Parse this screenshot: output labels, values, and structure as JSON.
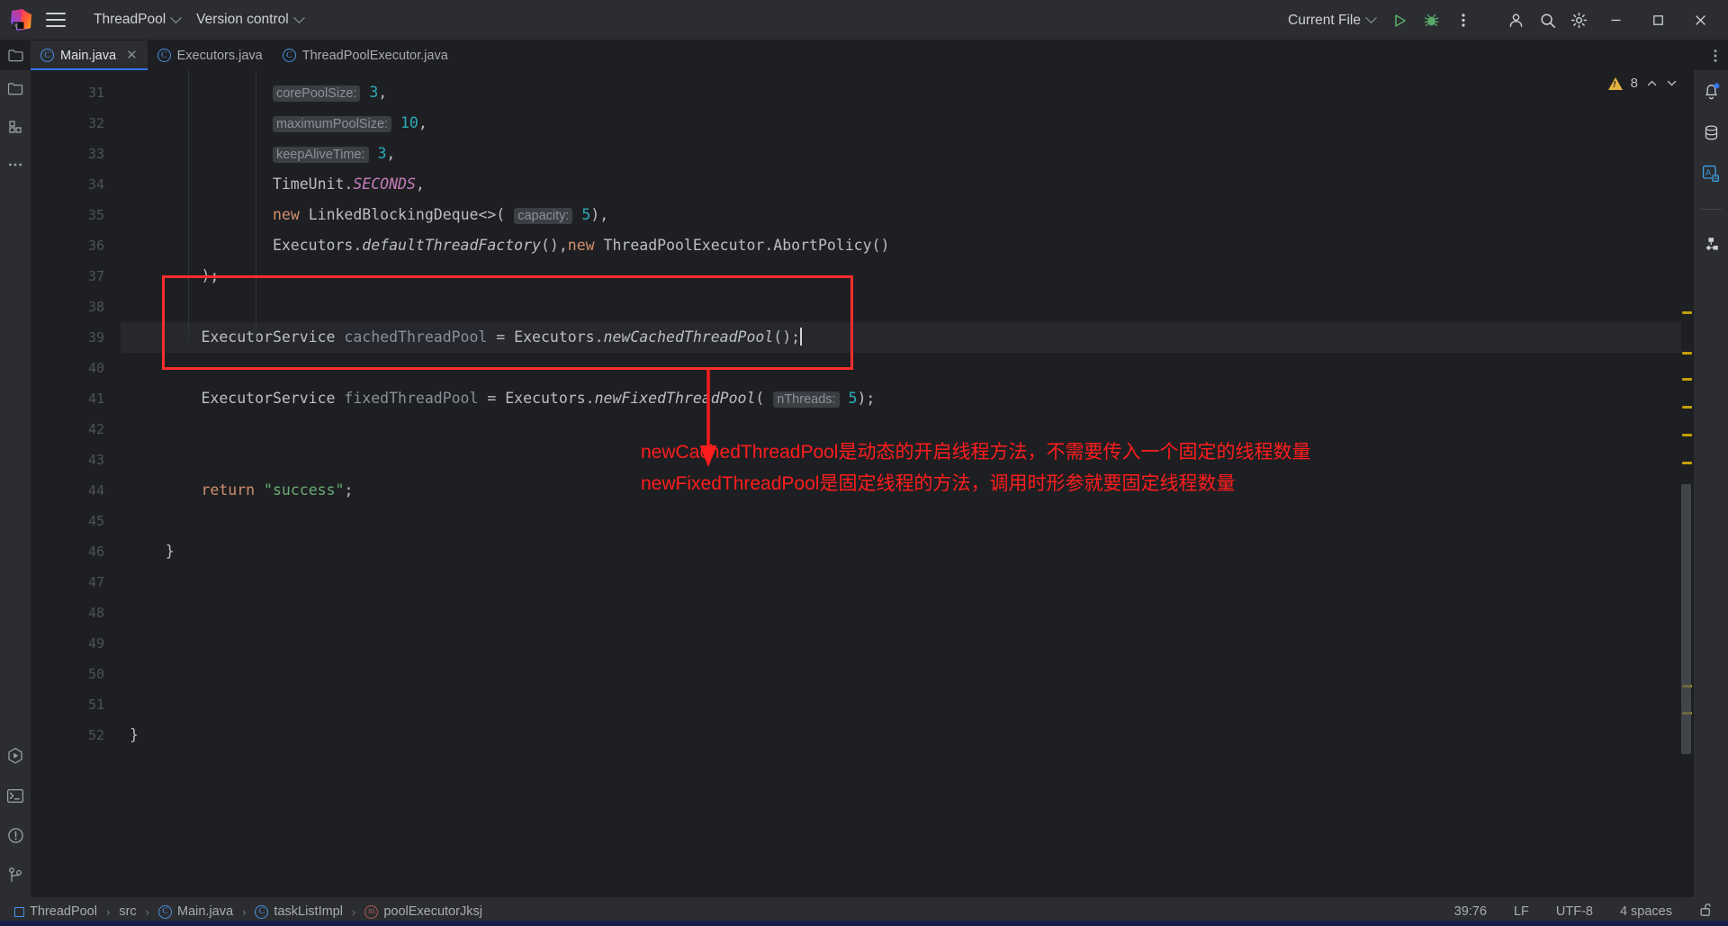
{
  "titlebar": {
    "project_name": "ThreadPool",
    "vcs_label": "Version control",
    "run_config": "Current File",
    "icons": {
      "app_logo": "intellij-idea-logo",
      "menu": "hamburger-menu-icon",
      "run": "run-icon",
      "debug": "debug-icon",
      "more": "more-vertical-icon",
      "account": "account-icon",
      "search": "search-icon",
      "settings": "gear-icon",
      "minimize": "minimize-icon",
      "maximize": "maximize-icon",
      "close": "close-icon"
    }
  },
  "tabs": [
    {
      "label": "Main.java",
      "active": true,
      "closable": true,
      "icon": "java-class-icon"
    },
    {
      "label": "Executors.java",
      "active": false,
      "closable": false,
      "icon": "java-class-icon"
    },
    {
      "label": "ThreadPoolExecutor.java",
      "active": false,
      "closable": false,
      "icon": "java-class-icon"
    }
  ],
  "left_rail": {
    "top": [
      "project-folder-icon",
      "structure-icon",
      "more-tool-windows-icon"
    ],
    "bottom": [
      "run-tool-window-icon",
      "terminal-icon",
      "problems-icon",
      "version-control-icon"
    ]
  },
  "right_rail": {
    "items": [
      "notifications-bell-icon",
      "database-icon",
      "translation-icon",
      "diagram-icon"
    ]
  },
  "inspections": {
    "warning_count": "8",
    "prev_icon": "chevron-up-icon",
    "next_icon": "chevron-down-icon"
  },
  "editor": {
    "first_line": 31,
    "current_line": 39,
    "lines": [
      {
        "n": 31,
        "indent": 0,
        "tokens": [
          {
            "t": "                ",
            "c": "plain"
          },
          {
            "t": "corePoolSize:",
            "c": "hint"
          },
          {
            "t": " ",
            "c": "plain"
          },
          {
            "t": "3",
            "c": "num"
          },
          {
            "t": ",",
            "c": "plain"
          }
        ]
      },
      {
        "n": 32,
        "indent": 0,
        "tokens": [
          {
            "t": "                ",
            "c": "plain"
          },
          {
            "t": "maximumPoolSize:",
            "c": "hint"
          },
          {
            "t": " ",
            "c": "plain"
          },
          {
            "t": "10",
            "c": "num"
          },
          {
            "t": ",",
            "c": "plain"
          }
        ]
      },
      {
        "n": 33,
        "indent": 0,
        "tokens": [
          {
            "t": "                ",
            "c": "plain"
          },
          {
            "t": "keepAliveTime:",
            "c": "hint"
          },
          {
            "t": " ",
            "c": "plain"
          },
          {
            "t": "3",
            "c": "num"
          },
          {
            "t": ",",
            "c": "plain"
          }
        ]
      },
      {
        "n": 34,
        "indent": 0,
        "tokens": [
          {
            "t": "                TimeUnit.",
            "c": "plain"
          },
          {
            "t": "SECONDS",
            "c": "field"
          },
          {
            "t": ",",
            "c": "plain"
          }
        ]
      },
      {
        "n": 35,
        "indent": 0,
        "tokens": [
          {
            "t": "                ",
            "c": "plain"
          },
          {
            "t": "new",
            "c": "kw"
          },
          {
            "t": " LinkedBlockingDeque<>( ",
            "c": "plain"
          },
          {
            "t": "capacity:",
            "c": "hint"
          },
          {
            "t": " ",
            "c": "plain"
          },
          {
            "t": "5",
            "c": "num"
          },
          {
            "t": "),",
            "c": "plain"
          }
        ]
      },
      {
        "n": 36,
        "indent": 0,
        "tokens": [
          {
            "t": "                Executors.",
            "c": "plain"
          },
          {
            "t": "defaultThreadFactory",
            "c": "method"
          },
          {
            "t": "(),",
            "c": "plain"
          },
          {
            "t": "new",
            "c": "kw"
          },
          {
            "t": " ThreadPoolExecutor.AbortPolicy()",
            "c": "plain"
          }
        ]
      },
      {
        "n": 37,
        "indent": 0,
        "tokens": [
          {
            "t": "        );",
            "c": "plain"
          }
        ]
      },
      {
        "n": 38,
        "indent": 0,
        "tokens": [
          {
            "t": "",
            "c": "plain"
          }
        ]
      },
      {
        "n": 39,
        "indent": 0,
        "tokens": [
          {
            "t": "        ExecutorService ",
            "c": "plain"
          },
          {
            "t": "cachedThreadPool",
            "c": "local"
          },
          {
            "t": " = Executors.",
            "c": "plain"
          },
          {
            "t": "newCachedThreadPool",
            "c": "method"
          },
          {
            "t": "();",
            "c": "plain"
          }
        ]
      },
      {
        "n": 40,
        "indent": 0,
        "tokens": [
          {
            "t": "",
            "c": "plain"
          }
        ]
      },
      {
        "n": 41,
        "indent": 0,
        "tokens": [
          {
            "t": "        ExecutorService ",
            "c": "plain"
          },
          {
            "t": "fixedThreadPool",
            "c": "local"
          },
          {
            "t": " = Executors.",
            "c": "plain"
          },
          {
            "t": "newFixedThreadPool",
            "c": "method"
          },
          {
            "t": "( ",
            "c": "plain"
          },
          {
            "t": "nThreads:",
            "c": "hint"
          },
          {
            "t": " ",
            "c": "plain"
          },
          {
            "t": "5",
            "c": "num"
          },
          {
            "t": ");",
            "c": "plain"
          }
        ]
      },
      {
        "n": 42,
        "indent": 0,
        "tokens": [
          {
            "t": "",
            "c": "plain"
          }
        ]
      },
      {
        "n": 43,
        "indent": 0,
        "tokens": [
          {
            "t": "",
            "c": "plain"
          }
        ]
      },
      {
        "n": 44,
        "indent": 0,
        "tokens": [
          {
            "t": "        ",
            "c": "plain"
          },
          {
            "t": "return",
            "c": "kw"
          },
          {
            "t": " ",
            "c": "plain"
          },
          {
            "t": "\"success\"",
            "c": "str"
          },
          {
            "t": ";",
            "c": "plain"
          }
        ]
      },
      {
        "n": 45,
        "indent": 0,
        "tokens": [
          {
            "t": "",
            "c": "plain"
          }
        ]
      },
      {
        "n": 46,
        "indent": 0,
        "tokens": [
          {
            "t": "    }",
            "c": "plain"
          }
        ]
      },
      {
        "n": 47,
        "indent": 0,
        "tokens": [
          {
            "t": "",
            "c": "plain"
          }
        ]
      },
      {
        "n": 48,
        "indent": 0,
        "tokens": [
          {
            "t": "",
            "c": "plain"
          }
        ]
      },
      {
        "n": 49,
        "indent": 0,
        "tokens": [
          {
            "t": "",
            "c": "plain"
          }
        ]
      },
      {
        "n": 50,
        "indent": 0,
        "tokens": [
          {
            "t": "",
            "c": "plain"
          }
        ]
      },
      {
        "n": 51,
        "indent": 0,
        "tokens": [
          {
            "t": "",
            "c": "plain"
          }
        ]
      },
      {
        "n": 52,
        "indent": 0,
        "tokens": [
          {
            "t": "}",
            "c": "plain"
          }
        ]
      }
    ]
  },
  "annotation": {
    "color": "#ff1d1d",
    "box_target_lines": [
      39,
      41
    ],
    "line1": "newCachedThreadPool是动态的开启线程方法，不需要传入一个固定的线程数量",
    "line2": "newFixedThreadPool是固定线程的方法，调用时形参就要固定线程数量"
  },
  "statusbar": {
    "breadcrumbs": [
      {
        "label": "ThreadPool",
        "icon": "module-icon"
      },
      {
        "label": "src",
        "icon": "none"
      },
      {
        "label": "Main.java",
        "icon": "java-class-icon"
      },
      {
        "label": "taskListImpl",
        "icon": "java-class-icon"
      },
      {
        "label": "poolExecutorJksj",
        "icon": "java-method-icon"
      }
    ],
    "caret_position": "39:76",
    "line_separator": "LF",
    "encoding": "UTF-8",
    "indent": "4 spaces",
    "lock_icon": "unlocked-padlock-icon"
  },
  "colors": {
    "accent_blue": "#3574f0",
    "annotation_red": "#ff1d1d",
    "warning_yellow": "#e3b341",
    "run_green": "#59a869",
    "editor_bg": "#1e1f22",
    "panel_bg": "#2b2d30"
  }
}
